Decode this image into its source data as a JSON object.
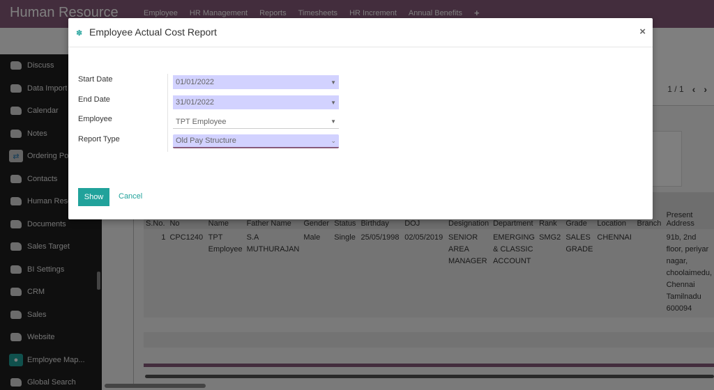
{
  "navbar": {
    "brand": "Human Resource",
    "menu": [
      "Employee",
      "HR Management",
      "Reports",
      "Timesheets",
      "HR Increment",
      "Annual Benefits",
      "+"
    ]
  },
  "sidebar": {
    "items": [
      {
        "label": "Discuss",
        "icon": "app-default-icon"
      },
      {
        "label": "Data Import",
        "icon": "app-default-icon"
      },
      {
        "label": "Calendar",
        "icon": "app-default-icon"
      },
      {
        "label": "Notes",
        "icon": "app-default-icon"
      },
      {
        "label": "Ordering Po",
        "icon": "handshake-icon"
      },
      {
        "label": "Contacts",
        "icon": "app-default-icon"
      },
      {
        "label": "Human Reso",
        "icon": "app-default-icon"
      },
      {
        "label": "Documents",
        "icon": "app-default-icon"
      },
      {
        "label": "Sales Target",
        "icon": "app-default-icon"
      },
      {
        "label": "BI Settings",
        "icon": "app-default-icon"
      },
      {
        "label": "CRM",
        "icon": "app-default-icon"
      },
      {
        "label": "Sales",
        "icon": "app-default-icon"
      },
      {
        "label": "Website",
        "icon": "app-default-icon"
      },
      {
        "label": "Employee Map...",
        "icon": "map-pin-icon"
      },
      {
        "label": "Global Search",
        "icon": "app-default-icon"
      }
    ]
  },
  "pager": {
    "value": "1 / 1",
    "prev": "‹",
    "next": "›"
  },
  "report": {
    "columns": [
      "S.No.",
      "No",
      "Name",
      "Father Name",
      "Gender",
      "Status",
      "Birthday",
      "DOJ",
      "Designation",
      "Department",
      "Rank",
      "Grade",
      "Location",
      "Branch",
      "Present Address"
    ],
    "rows": [
      [
        "1",
        "CPC1240",
        "TPT Employee",
        "S.A MUTHURAJAN",
        "Male",
        "Single",
        "25/05/1998",
        "02/05/2019",
        "SENIOR AREA MANAGER",
        "EMERGING & CLASSIC ACCOUNT",
        "SMG2",
        "SALES GRADE",
        "CHENNAI",
        "",
        "91b, 2nd floor, periyar nagar, choolaimedu, Chennai Tamilnadu 600094"
      ]
    ]
  },
  "modal": {
    "title": "Employee Actual Cost Report",
    "close": "×",
    "fields": [
      {
        "label": "Start Date",
        "value": "01/01/2022"
      },
      {
        "label": "End Date",
        "value": "31/01/2022"
      },
      {
        "label": "Employee",
        "value": "TPT Employee"
      },
      {
        "label": "Report Type",
        "value": "Old Pay Structure"
      }
    ],
    "show_label": "Show",
    "cancel_label": "Cancel"
  },
  "colors": {
    "brand": "#875a7b",
    "accent": "#21a29b",
    "required_field": "#d2d2ff"
  }
}
